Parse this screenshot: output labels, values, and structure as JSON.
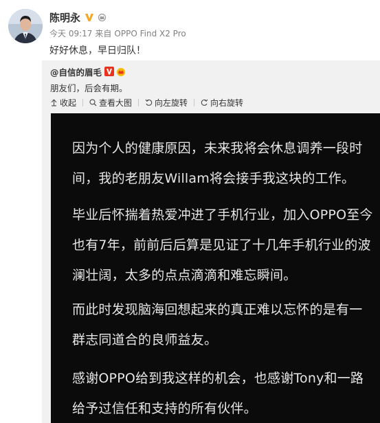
{
  "post": {
    "author": "陈明永",
    "time": "今天 09:17",
    "source_prefix": "来自",
    "source": "OPPO Find X2 Pro",
    "text": "好好休息，早日归队！"
  },
  "repost": {
    "author": "@自信的眉毛",
    "text": "朋友们，后会有期。",
    "toolbar": {
      "collapse": "收起",
      "view_large": "查看大图",
      "rotate_left": "向左旋转",
      "rotate_right": "向右旋转"
    },
    "image_paragraphs": [
      "因为个人的健康原因，未来我将会休息调养一段时间，我的老朋友Willam将会接手我这块的工作。",
      "毕业后怀揣着热爱冲进了手机行业，加入OPPO至今也有7年，前前后后算是见证了十几年手机行业的波澜壮阔，太多的点点滴滴和难忘瞬间。",
      "而此时发现脑海回想起来的真正难以忘怀的是有一群志同道合的良师益友。",
      "感谢OPPO给到我这样的机会，也感谢Tony和一路给予过信任和支持的所有伙伴。"
    ]
  },
  "colors": {
    "accent": "#eb7350",
    "image_bg": "#0b0b0b",
    "repost_bg": "#f1f1f1"
  },
  "icons": [
    "avatar",
    "verified-v-icon",
    "level-crown-icon",
    "collapse-arrow-icon",
    "magnifier-icon",
    "rotate-left-icon",
    "rotate-right-icon"
  ]
}
